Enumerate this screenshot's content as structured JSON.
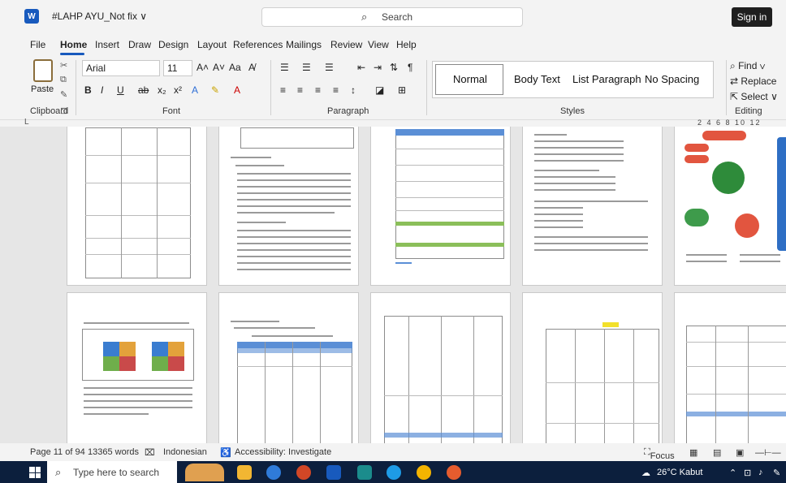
{
  "titlebar": {
    "app_icon": "W",
    "doc_title": "#LAHP AYU_Not fix ∨",
    "search_placeholder": "Search",
    "sign_in": "Sign in"
  },
  "menu": {
    "tabs": [
      "File",
      "Home",
      "Insert",
      "Draw",
      "Design",
      "Layout",
      "References",
      "Mailings",
      "Review",
      "View",
      "Help"
    ],
    "active": "Home"
  },
  "ribbon": {
    "clipboard": {
      "paste": "Paste",
      "group": "Clipboard"
    },
    "font": {
      "family": "Arial",
      "size": "11",
      "group": "Font"
    },
    "paragraph": {
      "group": "Paragraph"
    },
    "styles": {
      "items": [
        "Normal",
        "Body Text",
        "List Paragraph",
        "No Spacing"
      ],
      "group": "Styles"
    },
    "editing": {
      "find": "Find ∨",
      "replace": "Replace",
      "select": "Select ∨",
      "group": "Editing"
    }
  },
  "ruler": {
    "left_marker": "L",
    "numbers": "2 4 6 8 10 12"
  },
  "status": {
    "page": "Page 11 of 94",
    "words": "13365 words",
    "language": "Indonesian",
    "accessibility": "Accessibility: Investigate",
    "focus": "Focus"
  },
  "taskbar": {
    "search_placeholder": "Type here to search",
    "weather": "26°C Kabut"
  }
}
